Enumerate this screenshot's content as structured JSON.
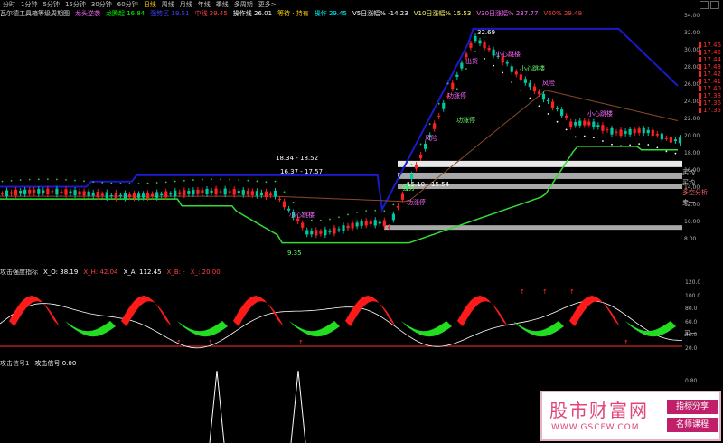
{
  "tabs": [
    "分时",
    "1分钟",
    "5分钟",
    "15分钟",
    "30分钟",
    "60分钟",
    "日线",
    "周线",
    "月线",
    "年线",
    "季线",
    "多周期",
    "更多>"
  ],
  "active_tab": 6,
  "main_legend": [
    {
      "text": "瓦尔德工具箱等级周期图",
      "color": "#d8d8d8"
    },
    {
      "text": "龙头逆袭",
      "color": "#ff66ff"
    },
    {
      "text": "龙腾起 16.84",
      "color": "#00ff00"
    },
    {
      "text": "强势区 19.51",
      "color": "#4040ff"
    },
    {
      "text": "中线 29.45",
      "color": "#ff4040"
    },
    {
      "text": "操作线 26.01",
      "color": "#ffffff"
    },
    {
      "text": "等待 · 持有",
      "color": "#ffd400"
    },
    {
      "text": "操作 29.45",
      "color": "#00ffff"
    },
    {
      "text": "V5日涨幅% -14.23",
      "color": "#ffffff"
    },
    {
      "text": "V10日涨幅% 15.53",
      "color": "#ffff66"
    },
    {
      "text": "V30日涨幅% 237.77",
      "color": "#ff66ff"
    },
    {
      "text": "V60% 29.49",
      "color": "#ff4040"
    }
  ],
  "main_axis": [
    "34.00",
    "32.00",
    "30.00",
    "28.00",
    "26.00",
    "24.00",
    "22.00",
    "20.00",
    "18.00",
    "16.00",
    "14.00",
    "12.00",
    "10.00",
    "8.00"
  ],
  "price_tags": [
    "17.46",
    "17.45",
    "17.44",
    "17.43",
    "17.42",
    "17.41",
    "17.40",
    "17.38",
    "17.36",
    "17.35"
  ],
  "side_buttons": [
    "买均",
    "买均",
    "多空分析",
    "卖一"
  ],
  "zone_labels": [
    "18.34 - 18.52",
    "16.37 - 17.57",
    "15.10 - 15.54"
  ],
  "chart_notes": [
    "32.69",
    "小心跳楼",
    "出货",
    "小心跳楼",
    "风险",
    "功涨停",
    "功涨停",
    "小心跳楼",
    "风险",
    "强势",
    "功涨停",
    "小心跳楼",
    "9.35"
  ],
  "osc_legend": [
    {
      "text": "攻击强度指标",
      "color": "#d8d8d8"
    },
    {
      "text": "X_O: 38.19",
      "color": "#ffffff"
    },
    {
      "text": "X_H: 42.04",
      "color": "#ff4040"
    },
    {
      "text": "X_A: 112.45",
      "color": "#ffffff"
    },
    {
      "text": "X_B: -",
      "color": "#ff4040"
    },
    {
      "text": "X_: 20.00",
      "color": "#ff4040"
    }
  ],
  "osc_axis": [
    "120.0",
    "100.0",
    "80.0",
    "60.0",
    "40.0",
    "20.0"
  ],
  "osc_side": "买一",
  "sig_legend": [
    {
      "text": "攻击信号1",
      "color": "#d8d8d8"
    },
    {
      "text": "攻击信号 0.00",
      "color": "#ffffff"
    }
  ],
  "sig_axis": [
    "0.80",
    "0.00"
  ],
  "watermark": {
    "title": "股市财富网",
    "url": "WWW.GSCFW.COM",
    "badge1": "指标分享",
    "badge2": "名师课程"
  },
  "colors": {
    "up": "#ff2020",
    "down": "#00c8a0",
    "band_upper": "#1a1acc",
    "band_lower": "#33dd33",
    "ma": "#8b4a2a",
    "dots": "#33cc33",
    "osc_red": "#ff1a1a",
    "osc_green": "#22dd22"
  }
}
